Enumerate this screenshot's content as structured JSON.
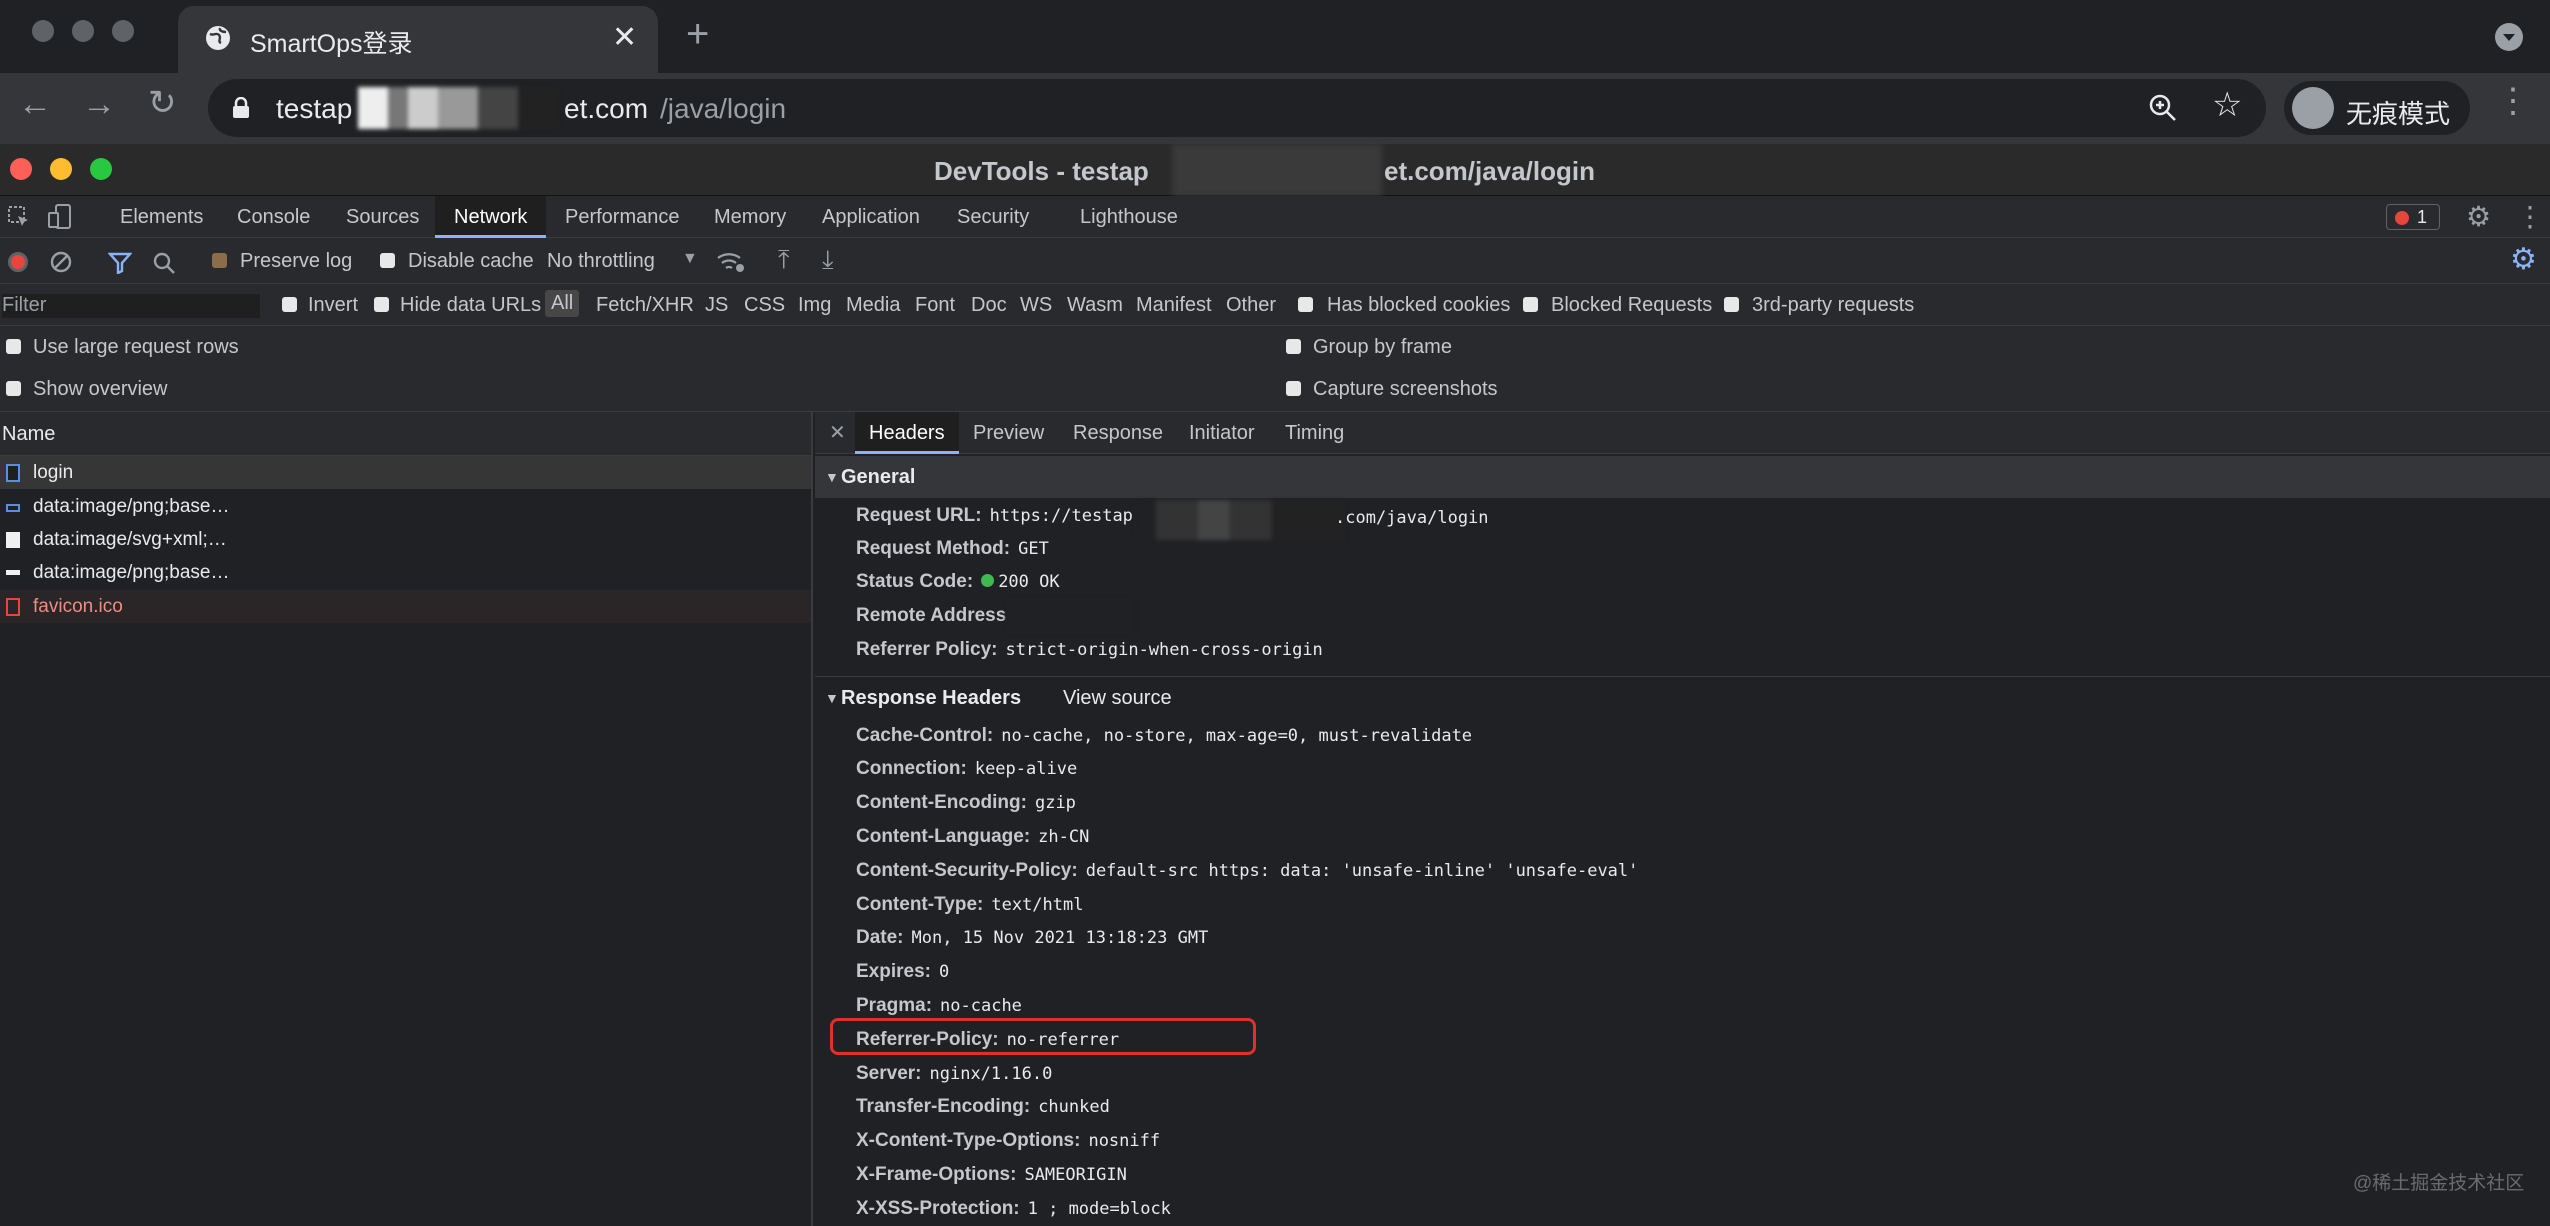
{
  "browser": {
    "tab_title": "SmartOps登录",
    "url_host": "testap",
    "url_mid": "et.com",
    "url_path": "/java/login",
    "incognito_label": "无痕模式"
  },
  "devtools": {
    "title_prefix": "DevTools - testap",
    "title_suffix": "et.com/java/login",
    "tabs": [
      "Elements",
      "Console",
      "Sources",
      "Network",
      "Performance",
      "Memory",
      "Application",
      "Security",
      "Lighthouse"
    ],
    "error_count": "1"
  },
  "network_toolbar": {
    "preserve_log": "Preserve log",
    "disable_cache": "Disable cache",
    "throttling": "No throttling"
  },
  "filter_bar": {
    "placeholder": "Filter",
    "invert": "Invert",
    "hide_data_urls": "Hide data URLs",
    "types": [
      "All",
      "Fetch/XHR",
      "JS",
      "CSS",
      "Img",
      "Media",
      "Font",
      "Doc",
      "WS",
      "Wasm",
      "Manifest",
      "Other"
    ],
    "has_blocked_cookies": "Has blocked cookies",
    "blocked_requests": "Blocked Requests",
    "third_party": "3rd-party requests"
  },
  "settings": {
    "large_rows": "Use large request rows",
    "show_overview": "Show overview",
    "group_by_frame": "Group by frame",
    "capture_screenshots": "Capture screenshots"
  },
  "requests": {
    "header": "Name",
    "items": [
      {
        "name": "login",
        "color": "#e8eaed"
      },
      {
        "name": "data:image/png;base…",
        "color": "#e8eaed"
      },
      {
        "name": "data:image/svg+xml;…",
        "color": "#e8eaed"
      },
      {
        "name": "data:image/png;base…",
        "color": "#e8eaed"
      },
      {
        "name": "favicon.ico",
        "color": "#f28b82"
      }
    ]
  },
  "details": {
    "tabs": [
      "Headers",
      "Preview",
      "Response",
      "Initiator",
      "Timing"
    ],
    "general_title": "General",
    "general": [
      {
        "k": "Request URL:",
        "v": "https://testap"
      },
      {
        "k": "Request Method:",
        "v": "GET"
      },
      {
        "k": "Status Code:",
        "v": "200 OK"
      },
      {
        "k": "Remote Address:",
        "v": ""
      },
      {
        "k": "Referrer Policy:",
        "v": "strict-origin-when-cross-origin"
      }
    ],
    "request_url_tail": ".com/java/login",
    "response_title": "Response Headers",
    "view_source": "View source",
    "response": [
      {
        "k": "Cache-Control:",
        "v": "no-cache, no-store, max-age=0, must-revalidate"
      },
      {
        "k": "Connection:",
        "v": "keep-alive"
      },
      {
        "k": "Content-Encoding:",
        "v": "gzip"
      },
      {
        "k": "Content-Language:",
        "v": "zh-CN"
      },
      {
        "k": "Content-Security-Policy:",
        "v": "default-src https: data: 'unsafe-inline' 'unsafe-eval'"
      },
      {
        "k": "Content-Type:",
        "v": "text/html"
      },
      {
        "k": "Date:",
        "v": "Mon, 15 Nov 2021 13:18:23 GMT"
      },
      {
        "k": "Expires:",
        "v": "0"
      },
      {
        "k": "Pragma:",
        "v": "no-cache"
      },
      {
        "k": "Referrer-Policy:",
        "v": "no-referrer"
      },
      {
        "k": "Server:",
        "v": "nginx/1.16.0"
      },
      {
        "k": "Transfer-Encoding:",
        "v": "chunked"
      },
      {
        "k": "X-Content-Type-Options:",
        "v": "nosniff"
      },
      {
        "k": "X-Frame-Options:",
        "v": "SAMEORIGIN"
      },
      {
        "k": "X-XSS-Protection:",
        "v": "1 ; mode=block"
      }
    ]
  },
  "watermark": "@稀土掘金技术社区",
  "colors": {
    "highlight": "#e0302a",
    "accent": "#8ab4f8",
    "status_ok": "#3fb950"
  }
}
